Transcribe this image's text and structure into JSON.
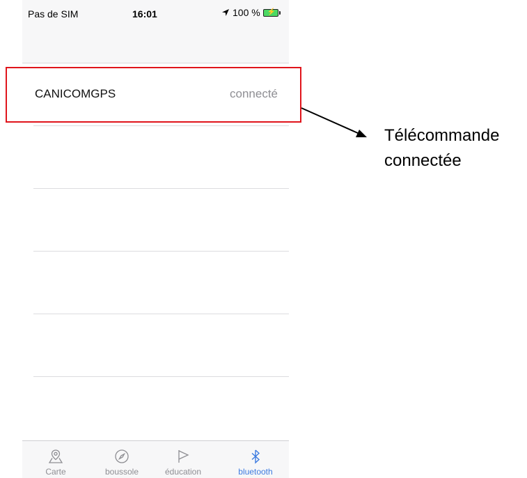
{
  "status_bar": {
    "carrier": "Pas de SIM",
    "time": "16:01",
    "battery": "100 %"
  },
  "devices": [
    {
      "name": "CANICOMGPS",
      "status": "connecté"
    }
  ],
  "tabs": [
    {
      "label": "Carte",
      "icon": "map-pin-icon",
      "active": false
    },
    {
      "label": "boussole",
      "icon": "compass-icon",
      "active": false
    },
    {
      "label": "éducation",
      "icon": "flag-icon",
      "active": false
    },
    {
      "label": "bluetooth",
      "icon": "bluetooth-icon",
      "active": true
    }
  ],
  "annotation": {
    "line1": "Télécommande",
    "line2": "connectée"
  },
  "colors": {
    "highlight": "#e0141b",
    "active_tab": "#3d7be0",
    "inactive_tab": "#8e8e93",
    "battery": "#4cd964"
  }
}
